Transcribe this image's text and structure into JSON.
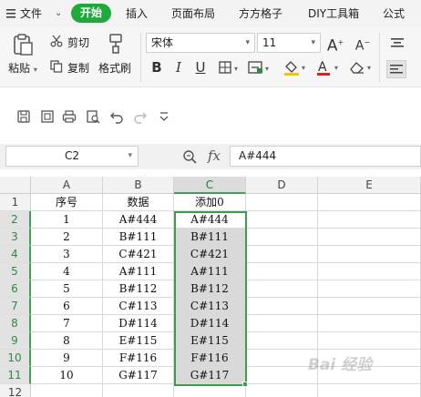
{
  "tabs": {
    "file": "文件",
    "active": "开始",
    "items": [
      "插入",
      "页面布局",
      "方方格子",
      "DIY工具箱",
      "公式"
    ]
  },
  "ribbon": {
    "paste": "粘贴",
    "cut": "剪切",
    "copy": "复制",
    "format_painter": "格式刷",
    "font_name": "宋体",
    "font_size": "11"
  },
  "namebox": "C2",
  "fx_label": "fx",
  "formula": "A#444",
  "sheet": {
    "columns": [
      "A",
      "B",
      "C",
      "D",
      "E"
    ],
    "row_numbers": [
      "1",
      "2",
      "3",
      "4",
      "5",
      "6",
      "7",
      "8",
      "9",
      "10",
      "11",
      "12"
    ],
    "rows": [
      [
        "序号",
        "数据",
        "添加0"
      ],
      [
        "1",
        "A#444",
        "A#444"
      ],
      [
        "2",
        "B#111",
        "B#111"
      ],
      [
        "3",
        "C#421",
        "C#421"
      ],
      [
        "4",
        "A#111",
        "A#111"
      ],
      [
        "5",
        "B#112",
        "B#112"
      ],
      [
        "6",
        "C#113",
        "C#113"
      ],
      [
        "7",
        "D#114",
        "D#114"
      ],
      [
        "8",
        "E#115",
        "E#115"
      ],
      [
        "9",
        "F#116",
        "F#116"
      ],
      [
        "10",
        "G#117",
        "G#117"
      ]
    ],
    "selected_column": "C",
    "selected_rows": [
      "2",
      "3",
      "4",
      "5",
      "6",
      "7",
      "8",
      "9",
      "10",
      "11"
    ]
  },
  "watermark": "Bai 经验",
  "colors": {
    "accent": "#1eaa3a",
    "selection_border": "#3e9c4f",
    "selection_fill": "#d9d9d9"
  },
  "icons": [
    "chevron-down-icon",
    "paste-icon",
    "scissors-icon",
    "copy-icon",
    "format-painter-icon",
    "bold-icon",
    "italic-icon",
    "underline-icon",
    "borders-icon",
    "merge-icon",
    "fill-color-icon",
    "font-color-icon",
    "eraser-icon",
    "increase-font-icon",
    "decrease-font-icon",
    "align-icon",
    "save-icon",
    "print-preview-icon",
    "print-icon",
    "preview-icon",
    "undo-icon",
    "redo-icon",
    "customize-icon",
    "zoom-icon"
  ]
}
